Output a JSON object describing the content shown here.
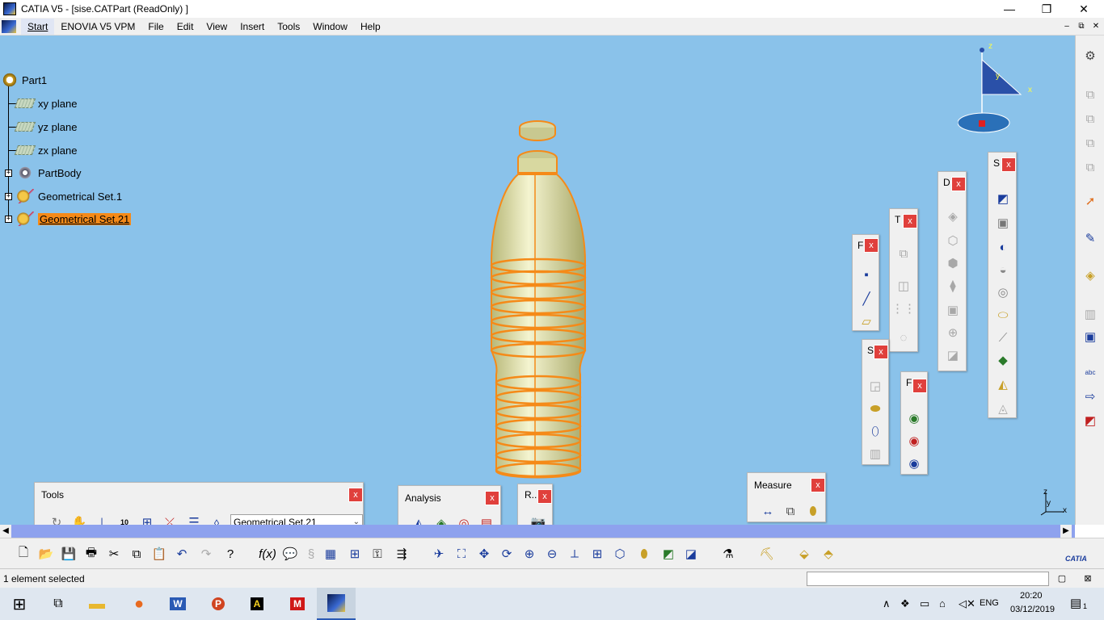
{
  "window": {
    "title": "CATIA V5 - [sise.CATPart (ReadOnly) ]",
    "minimize": "—",
    "maximize": "❐",
    "close": "✕"
  },
  "menubar": {
    "items": [
      "Start",
      "ENOVIA V5 VPM",
      "File",
      "Edit",
      "View",
      "Insert",
      "Tools",
      "Window",
      "Help"
    ],
    "mdi": [
      "–",
      "⧉",
      "✕"
    ]
  },
  "tree": {
    "root": "Part1",
    "items": [
      {
        "label": "xy plane",
        "icon": "plane-icon"
      },
      {
        "label": "yz plane",
        "icon": "plane-icon"
      },
      {
        "label": "zx plane",
        "icon": "plane-icon"
      },
      {
        "label": "PartBody",
        "icon": "body-icon"
      },
      {
        "label": "Geometrical Set.1",
        "icon": "geoset-icon"
      },
      {
        "label": "Geometrical Set.21",
        "icon": "geoset-icon",
        "selected": true
      }
    ]
  },
  "compass": {
    "x": "x",
    "y": "y",
    "z": "z"
  },
  "axis_corner": {
    "x": "x",
    "y": "y",
    "z": "z"
  },
  "toolbars": {
    "tools": {
      "title": "Tools",
      "close": "x",
      "combo_value": "Geometrical Set.21"
    },
    "analysis": {
      "title": "Analysis",
      "close": "x"
    },
    "render": {
      "title": "R..",
      "close": "x"
    },
    "measure": {
      "title": "Measure",
      "close": "x"
    },
    "t_f": {
      "title": "F",
      "close": "x"
    },
    "t_t": {
      "title": "T",
      "close": "x"
    },
    "t_d": {
      "title": "D",
      "close": "x"
    },
    "t_s1": {
      "title": "S",
      "close": "x"
    },
    "t_s2": {
      "title": "S",
      "close": "x"
    },
    "t_f2": {
      "title": "F",
      "close": "x"
    }
  },
  "statusbar": {
    "text": "1 element selected"
  },
  "taskbar": {
    "lang": "ENG",
    "time": "20:20",
    "date": "03/12/2019",
    "notifications": "1"
  },
  "brand": {
    "logo_text": "CATIA"
  },
  "colors": {
    "viewport": "#8ac2ea",
    "selection": "#f58a18",
    "scrollbar": "#8ea2ee",
    "close_button": "#e0403c"
  }
}
